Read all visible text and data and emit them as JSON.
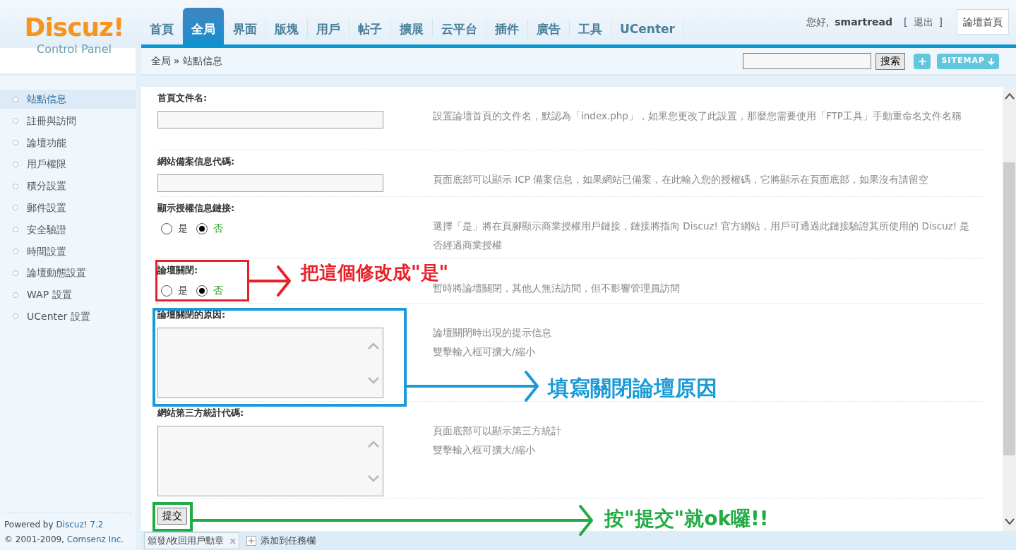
{
  "logo": {
    "name": "Discuz!",
    "subtitle": "Control Panel"
  },
  "nav_tabs": [
    {
      "label": "首頁",
      "selected": false
    },
    {
      "label": "全局",
      "selected": true
    },
    {
      "label": "界面",
      "selected": false
    },
    {
      "label": "版塊",
      "selected": false
    },
    {
      "label": "用戶",
      "selected": false
    },
    {
      "label": "帖子",
      "selected": false
    },
    {
      "label": "擴展",
      "selected": false
    },
    {
      "label": "云平台",
      "selected": false
    },
    {
      "label": "插件",
      "selected": false
    },
    {
      "label": "廣告",
      "selected": false
    },
    {
      "label": "工具",
      "selected": false
    },
    {
      "label": "UCenter",
      "selected": false
    }
  ],
  "user": {
    "greeting": "您好,",
    "name": "smartread",
    "bracket_open": "[",
    "logout": "退出",
    "bracket_close": "]",
    "home_button": "論壇首頁"
  },
  "breadcrumb": {
    "items": [
      "全局",
      "站點信息"
    ],
    "separator": "»"
  },
  "search": {
    "button": "搜索",
    "add_button": "+",
    "sitemap_button": "SITEMAP"
  },
  "sidebar": {
    "items": [
      {
        "label": "站點信息",
        "selected": true
      },
      {
        "label": "註冊與訪問",
        "selected": false
      },
      {
        "label": "論壇功能",
        "selected": false
      },
      {
        "label": "用戶權限",
        "selected": false
      },
      {
        "label": "積分設置",
        "selected": false
      },
      {
        "label": "郵件設置",
        "selected": false
      },
      {
        "label": "安全驗證",
        "selected": false
      },
      {
        "label": "時間設置",
        "selected": false
      },
      {
        "label": "論壇動態設置",
        "selected": false
      },
      {
        "label": "WAP 設置",
        "selected": false
      },
      {
        "label": "UCenter 設置",
        "selected": false
      }
    ],
    "footer": {
      "powered_prefix": "Powered by ",
      "powered_link": "Discuz! 7.2",
      "copyright_prefix": "© 2001-2009, ",
      "copyright_link": "Comsenz Inc."
    }
  },
  "settings": [
    {
      "kind": "text",
      "label": "首頁文件名:",
      "hint": [
        "設置論壇首頁的文件名，默認為「index.php」，如果您更改了此設置，那麼您需要使用「FTP工具」手動重命名文件名稱"
      ]
    },
    {
      "kind": "text",
      "label": "網站備案信息代碼:",
      "hint": [
        "頁面底部可以顯示 ICP 備案信息，如果網站已備案，在此輸入您的授權碼，它將顯示在頁面底部，如果沒有請留空"
      ]
    },
    {
      "kind": "radio",
      "label": "顯示授權信息鏈接:",
      "options": [
        {
          "label": "是",
          "selected": false
        },
        {
          "label": "否",
          "selected": true
        }
      ],
      "hint": [
        "選擇「是」將在頁腳顯示商業授權用戶鏈接，鏈接將指向 Discuz! 官方網站，用戶可通過此鏈接驗證其所使用的 Discuz! 是否經過商業授權"
      ]
    },
    {
      "kind": "radio",
      "label": "論壇關閉:",
      "options": [
        {
          "label": "是",
          "selected": false
        },
        {
          "label": "否",
          "selected": true
        }
      ],
      "hint": [
        "暫時將論壇關閉，其他人無法訪問，但不影響管理員訪問"
      ]
    },
    {
      "kind": "textarea",
      "label": "論壇關閉的原因:",
      "hint": [
        "論壇關閉時出現的提示信息",
        "雙擊輸入框可擴大/縮小"
      ]
    },
    {
      "kind": "textarea",
      "label": "網站第三方統計代碼:",
      "hint": [
        "頁面底部可以顯示第三方統計",
        "雙擊輸入框可擴大/縮小"
      ]
    }
  ],
  "submit_button": "提交",
  "taskbar": {
    "tab": "頒發/收回用戶勳章",
    "close": "x",
    "add": "添加到任務欄"
  },
  "annotations": [
    {
      "text": "把這個修改成\"是\"",
      "color": "#e8202a"
    },
    {
      "text": "填寫關閉論壇原因",
      "color": "#1a9ad6"
    },
    {
      "text": "按\"提交\"就ok囉!!",
      "color": "#22aa44"
    }
  ]
}
